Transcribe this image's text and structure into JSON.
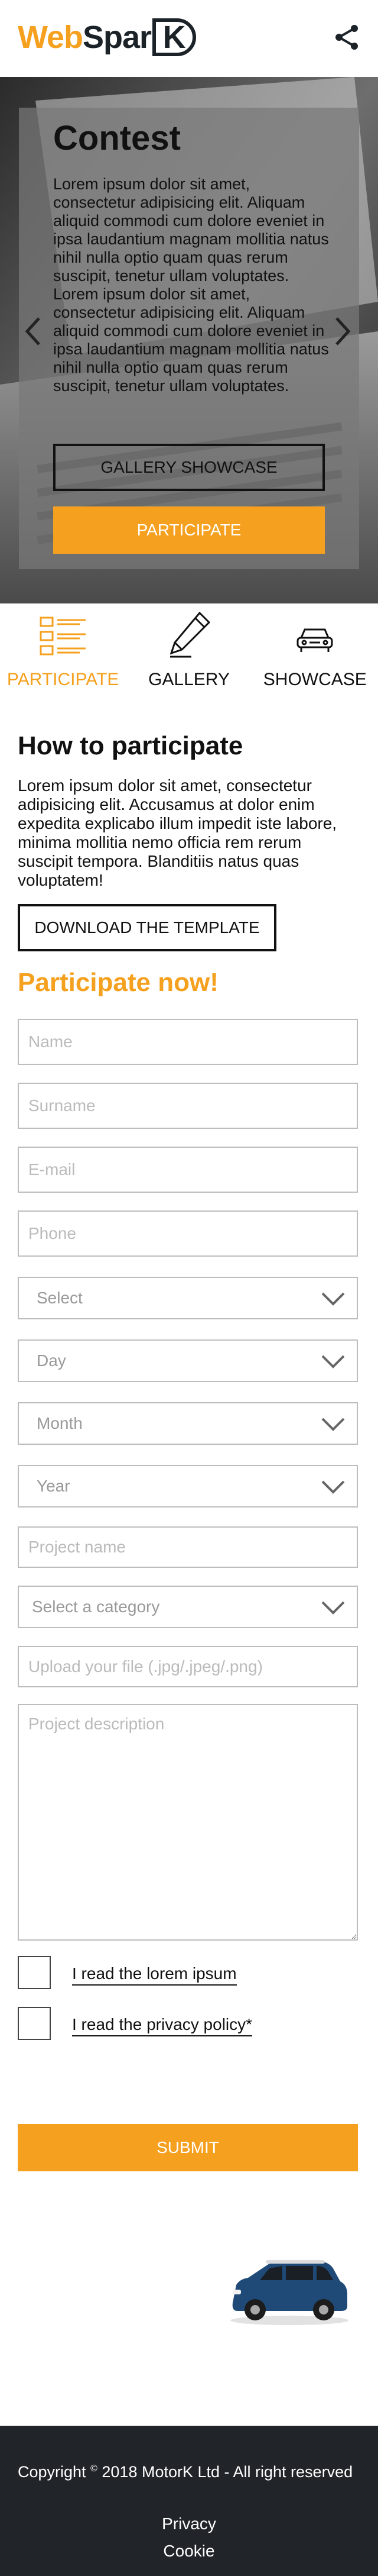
{
  "header": {
    "logo_web": "Web",
    "logo_spar": "Spar",
    "logo_k": "K"
  },
  "hero": {
    "title": "Contest",
    "paragraph": "Lorem ipsum dolor sit amet, consectetur adipisicing elit. Aliquam aliquid commodi cum dolore eveniet in ipsa laudantium magnam mollitia natus nihil nulla optio quam quas rerum suscipit, tenetur ullam voluptates. Lorem ipsum dolor sit amet, consectetur adipisicing elit. Aliquam aliquid commodi cum dolore eveniet in ipsa laudantium magnam mollitia natus nihil nulla optio quam quas rerum suscipit, tenetur ullam voluptates.",
    "gallery_showcase_label": "Gallery showcase",
    "participate_label": "Participate"
  },
  "tabs": [
    {
      "label": "Participate",
      "active": true
    },
    {
      "label": "Gallery",
      "active": false
    },
    {
      "label": "Showcase",
      "active": false
    }
  ],
  "how": {
    "title": "How to participate",
    "text": "Lorem ipsum dolor sit amet, consectetur adipisicing elit. Accusamus at dolor enim expedita explicabo illum impedit iste labore, minima mollitia nemo officia rem rerum suscipit tempora. Blanditiis natus quas voluptatem!",
    "download_label": "Download the template"
  },
  "form": {
    "title": "Participate now!",
    "name_placeholder": "Name",
    "surname_placeholder": "Surname",
    "email_placeholder": "E-mail",
    "phone_placeholder": "Phone",
    "select_value": "Select",
    "day_value": "Day",
    "month_value": "Month",
    "year_value": "Year",
    "project_name_placeholder": "Project name",
    "category_value": "Select a category",
    "upload_placeholder": "Upload your file (.jpg/.jpeg/.png)",
    "description_placeholder": "Project description",
    "check1_label": "I read the lorem ipsum",
    "check2_label": "I read the privacy policy*",
    "submit_label": "Submit"
  },
  "footer": {
    "copyright_prefix": "Copyright",
    "copyright_symbol": "©",
    "copyright_text": "2018 MotorK Ltd - All right reserved",
    "privacy": "Privacy",
    "cookie": "Cookie"
  },
  "colors": {
    "accent": "#f5a01e",
    "dark": "#212529"
  }
}
